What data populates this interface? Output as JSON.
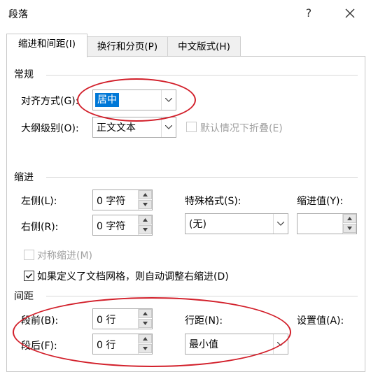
{
  "window": {
    "title": "段落",
    "help_label": "?",
    "close_label": "✕"
  },
  "tabs": [
    {
      "label": "缩进和间距(I)"
    },
    {
      "label": "换行和分页(P)"
    },
    {
      "label": "中文版式(H)"
    }
  ],
  "general": {
    "section_label": "常规",
    "alignment_label": "对齐方式(G):",
    "alignment_value": "居中",
    "outline_label": "大纲级别(O):",
    "outline_value": "正文文本",
    "collapse_label": "默认情况下折叠(E)",
    "collapse_checked": false
  },
  "indent": {
    "section_label": "缩进",
    "left_label": "左侧(L):",
    "left_value": "0 字符",
    "right_label": "右侧(R):",
    "right_value": "0 字符",
    "special_label": "特殊格式(S):",
    "special_value": "(无)",
    "by_label": "缩进值(Y):",
    "by_value": "",
    "mirror_label": "对称缩进(M)",
    "mirror_checked": false,
    "autoadjust_label": "如果定义了文档网格，则自动调整右缩进(D)",
    "autoadjust_checked": true
  },
  "spacing": {
    "section_label": "间距",
    "before_label": "段前(B):",
    "before_value": "0 行",
    "after_label": "段后(F):",
    "after_value": "0 行",
    "line_spacing_label": "行距(N):",
    "line_spacing_value": "最小值",
    "at_label": "设置值(A):"
  },
  "colors": {
    "annotation": "#d21f2a",
    "selection": "#0078d7"
  }
}
